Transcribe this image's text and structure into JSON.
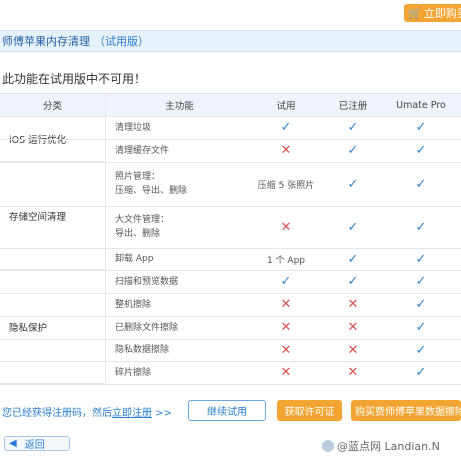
{
  "top": {
    "buy_label": "立即购买"
  },
  "titlebar": {
    "title": "师傅苹果内存清理",
    "trial_tag": "（试用版）"
  },
  "notice": "此功能在试用版中不可用！",
  "table": {
    "headers": [
      "分类",
      "主功能",
      "试用",
      "已注册",
      "Umate Pro"
    ],
    "categories": [
      "iOS 运行优化",
      "存储空间清理",
      "隐私保护"
    ],
    "rows": [
      {
        "fn": "清理垃圾",
        "trial": "check",
        "reg": "check",
        "pro": "check"
      },
      {
        "fn": "清理缓存文件",
        "trial": "cross",
        "reg": "check",
        "pro": "check"
      },
      {
        "fn_lines": [
          "照片管理：",
          "压缩、导出、删除"
        ],
        "trial_text": "压缩 5 张照片",
        "reg": "check",
        "pro": "check"
      },
      {
        "fn_lines": [
          "大文件管理：",
          "导出、删除"
        ],
        "trial": "cross",
        "reg": "check",
        "pro": "check"
      },
      {
        "fn": "卸载 App",
        "trial_text": "1 个 App",
        "reg": "check",
        "pro": "check"
      },
      {
        "fn": "扫描和预览数据",
        "trial": "check",
        "reg": "check",
        "pro": "check"
      },
      {
        "fn": "整机擦除",
        "trial": "cross",
        "reg": "cross",
        "pro": "check"
      },
      {
        "fn": "已删除文件擦除",
        "trial": "cross",
        "reg": "cross",
        "pro": "check"
      },
      {
        "fn": "隐私数据擦除",
        "trial": "cross",
        "reg": "cross",
        "pro": "check"
      },
      {
        "fn": "碎片擦除",
        "trial": "cross",
        "reg": "cross",
        "pro": "check"
      }
    ]
  },
  "bottom": {
    "register_prefix": "您已经获得注册码，然后",
    "register_link": "立即注册",
    "register_suffix": " >>",
    "continue_label": "继续试用",
    "license_label": "获取许可证",
    "buy_label": "购买费师傅苹果数据擦除"
  },
  "back_label": "返回",
  "watermark": "@蓝点网 Landian.N",
  "colors": {
    "accent_blue": "#2f86d1",
    "cross_red": "#d9534f",
    "orange": "#f3a533"
  }
}
